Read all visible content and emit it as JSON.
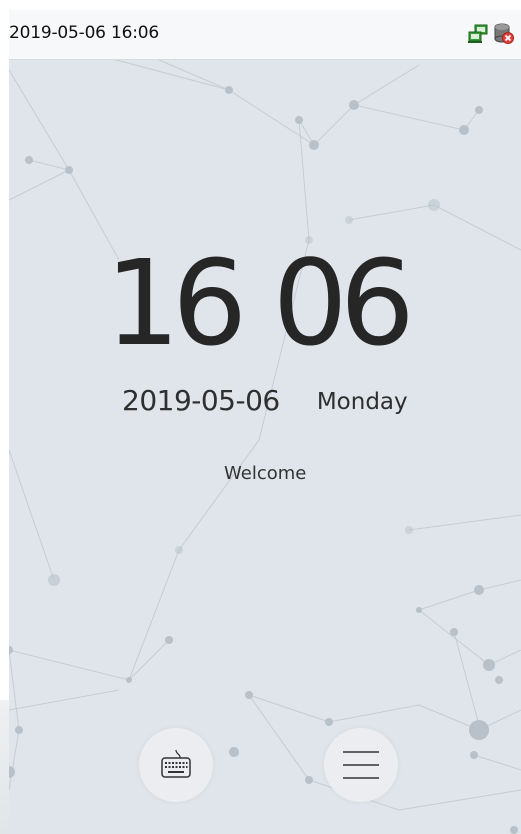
{
  "status_bar": {
    "datetime": "2019-05-06 16:06",
    "network_icon": "network-icon",
    "database_icon": "database-alert-icon"
  },
  "clock": {
    "time": "16 06",
    "date": "2019-05-06",
    "weekday": "Monday"
  },
  "message": {
    "welcome": "Welcome"
  },
  "buttons": {
    "keyboard_icon": "keyboard-icon",
    "menu_icon": "menu-icon"
  },
  "colors": {
    "background": "#dfe5ea",
    "text_dark": "#262626",
    "status_red": "#e0413b",
    "network_green": "#3a9b3a"
  }
}
